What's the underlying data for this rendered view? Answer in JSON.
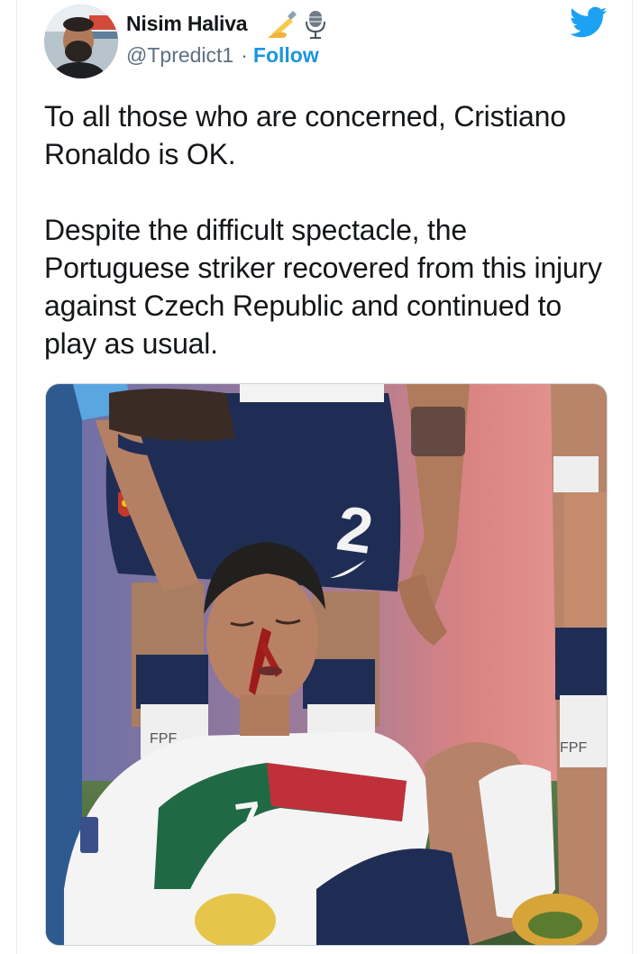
{
  "author": {
    "display_name": "Nisim Haliva",
    "name_emoji": [
      "writing-hand-icon",
      "microphone-icon"
    ],
    "handle": "@Tpredict1",
    "separator": "·",
    "follow_label": "Follow"
  },
  "tweet": {
    "paragraphs": [
      "To all those who are concerned, Cristiano Ronaldo is OK.",
      "Despite the difficult spectacle, the Portuguese striker recovered from this injury against Czech Republic and continued to play as usual."
    ]
  },
  "media": {
    "jersey_number_front": "2",
    "jersey_number_player": "7",
    "sock_brand": "FPF"
  },
  "colors": {
    "twitter_blue": "#1da1f2",
    "follow_blue": "#1b95e0",
    "text_dark": "#14171a",
    "text_gray": "#5b7083"
  }
}
